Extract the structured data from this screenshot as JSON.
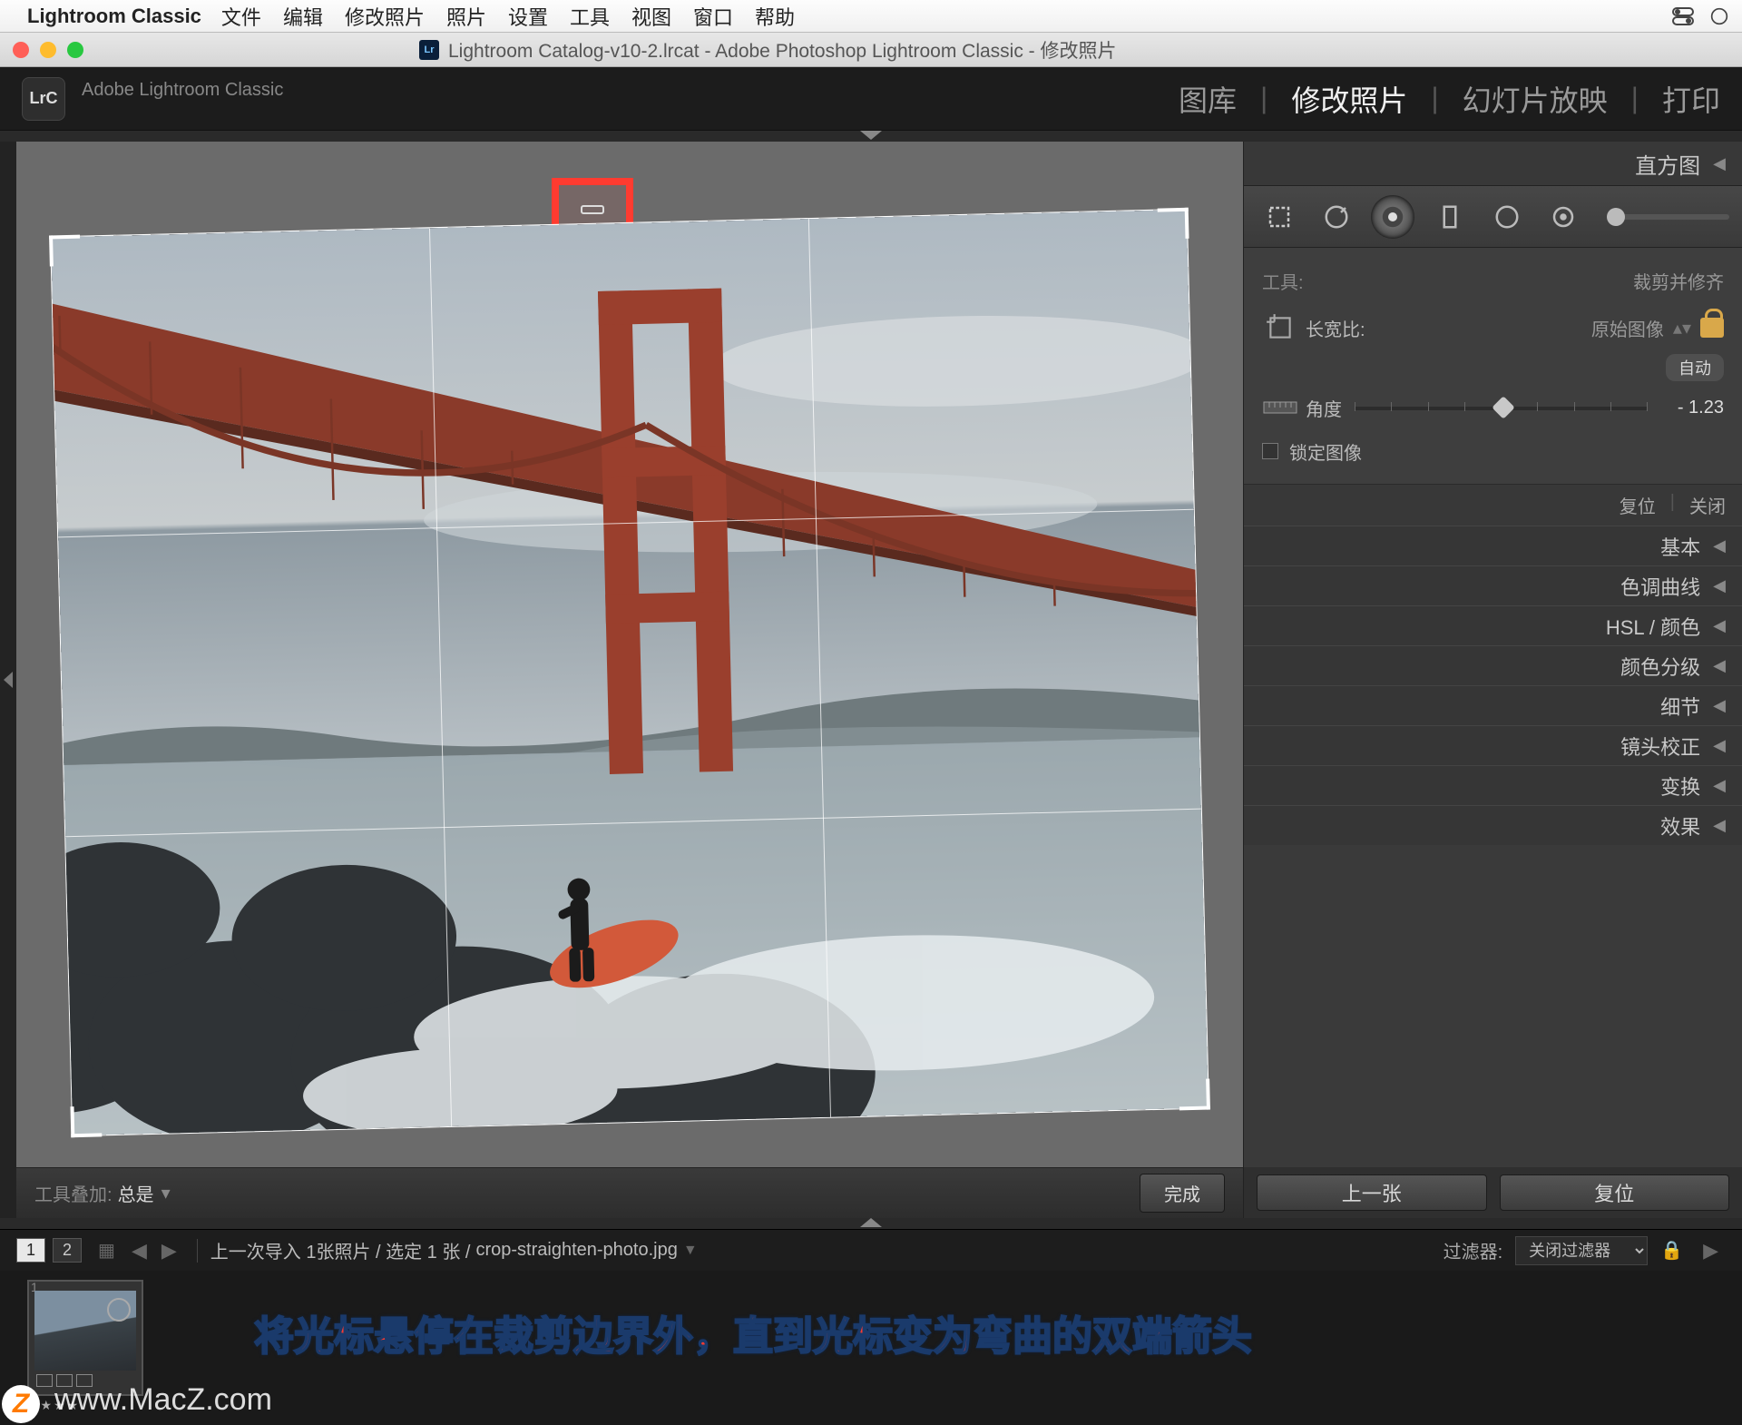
{
  "mac_menu": {
    "app": "Lightroom Classic",
    "items": [
      "文件",
      "编辑",
      "修改照片",
      "照片",
      "设置",
      "工具",
      "视图",
      "窗口",
      "帮助"
    ]
  },
  "window": {
    "title": "Lightroom Catalog-v10-2.lrcat - Adobe Photoshop Lightroom Classic - 修改照片",
    "badge": "Lr"
  },
  "header": {
    "badge": "LrC",
    "app_name": "Adobe Lightroom Classic",
    "tabs": {
      "library": "图库",
      "develop": "修改照片",
      "slideshow": "幻灯片放映",
      "print": "打印"
    }
  },
  "toolbar_bottom": {
    "label": "工具叠加:",
    "value": "总是",
    "done": "完成"
  },
  "right": {
    "histogram": "直方图",
    "tool_label": "工具:",
    "tool_name": "裁剪并修齐",
    "aspect_label": "长宽比:",
    "aspect_value": "原始图像",
    "angle_label": "角度",
    "angle_auto": "自动",
    "angle_value": "- 1.23",
    "lock_image": "锁定图像",
    "reset": "复位",
    "close": "关闭",
    "sections": {
      "basic": "基本",
      "tone_curve": "色调曲线",
      "hsl": "HSL / 颜色",
      "color_grading": "颜色分级",
      "detail": "细节",
      "lens": "镜头校正",
      "transform": "变换",
      "effects": "效果"
    },
    "prev": "上一张",
    "reset_btn": "复位"
  },
  "strip": {
    "page1": "1",
    "page2": "2",
    "crumb": "上一次导入   1张照片 / 选定 1 张 /",
    "filename": "crop-straighten-photo.jpg",
    "filter_label": "过滤器:",
    "filter_value": "关闭过滤器",
    "stars": "★★★★"
  },
  "annotation": "将光标悬停在裁剪边界外，直到光标变为弯曲的双端箭头",
  "watermark": "www.MacZ.com",
  "wm_badge": "Z"
}
